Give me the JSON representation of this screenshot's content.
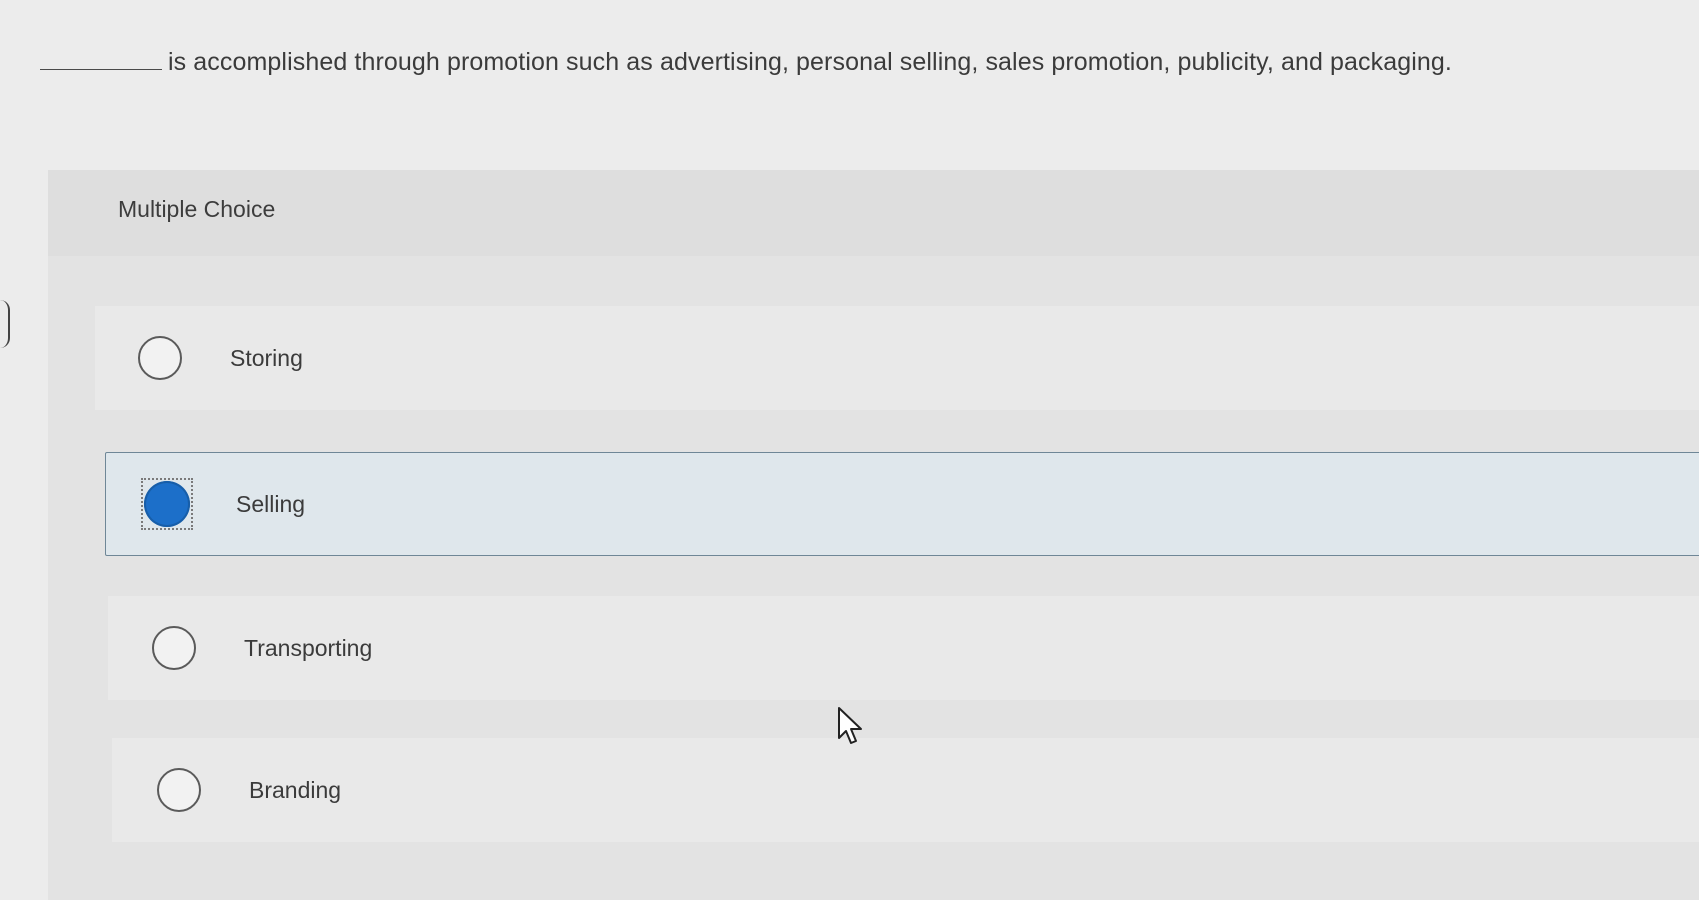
{
  "question": {
    "text": "is accomplished through promotion such as advertising, personal selling, sales promotion, publicity, and packaging."
  },
  "panel": {
    "heading": "Multiple Choice"
  },
  "options": [
    {
      "label": "Storing",
      "selected": false
    },
    {
      "label": "Selling",
      "selected": true
    },
    {
      "label": "Transporting",
      "selected": false
    },
    {
      "label": "Branding",
      "selected": false
    }
  ],
  "colors": {
    "selected_radio": "#1c6fc9",
    "selected_row_bg": "#dfe7ec",
    "page_bg": "#ececec"
  },
  "icons": {
    "cursor": "mouse-pointer-icon"
  }
}
